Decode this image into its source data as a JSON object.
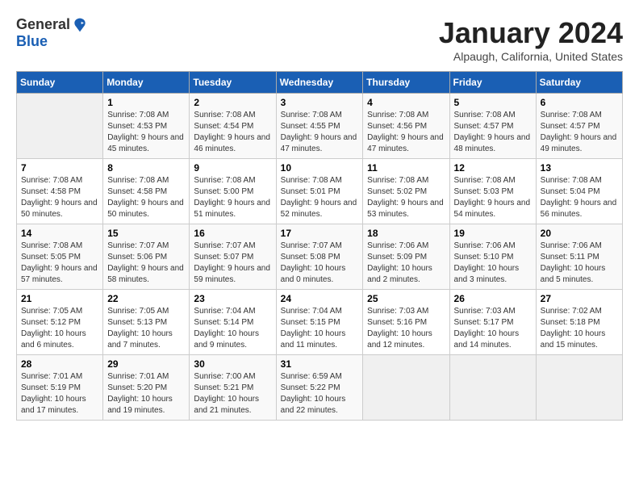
{
  "logo": {
    "general": "General",
    "blue": "Blue"
  },
  "title": "January 2024",
  "location": "Alpaugh, California, United States",
  "days_header": [
    "Sunday",
    "Monday",
    "Tuesday",
    "Wednesday",
    "Thursday",
    "Friday",
    "Saturday"
  ],
  "weeks": [
    [
      {
        "day": "",
        "sunrise": "",
        "sunset": "",
        "daylight": ""
      },
      {
        "day": "1",
        "sunrise": "Sunrise: 7:08 AM",
        "sunset": "Sunset: 4:53 PM",
        "daylight": "Daylight: 9 hours and 45 minutes."
      },
      {
        "day": "2",
        "sunrise": "Sunrise: 7:08 AM",
        "sunset": "Sunset: 4:54 PM",
        "daylight": "Daylight: 9 hours and 46 minutes."
      },
      {
        "day": "3",
        "sunrise": "Sunrise: 7:08 AM",
        "sunset": "Sunset: 4:55 PM",
        "daylight": "Daylight: 9 hours and 47 minutes."
      },
      {
        "day": "4",
        "sunrise": "Sunrise: 7:08 AM",
        "sunset": "Sunset: 4:56 PM",
        "daylight": "Daylight: 9 hours and 47 minutes."
      },
      {
        "day": "5",
        "sunrise": "Sunrise: 7:08 AM",
        "sunset": "Sunset: 4:57 PM",
        "daylight": "Daylight: 9 hours and 48 minutes."
      },
      {
        "day": "6",
        "sunrise": "Sunrise: 7:08 AM",
        "sunset": "Sunset: 4:57 PM",
        "daylight": "Daylight: 9 hours and 49 minutes."
      }
    ],
    [
      {
        "day": "7",
        "sunrise": "Sunrise: 7:08 AM",
        "sunset": "Sunset: 4:58 PM",
        "daylight": "Daylight: 9 hours and 50 minutes."
      },
      {
        "day": "8",
        "sunrise": "Sunrise: 7:08 AM",
        "sunset": "Sunset: 4:58 PM",
        "daylight": "Daylight: 9 hours and 50 minutes."
      },
      {
        "day": "9",
        "sunrise": "Sunrise: 7:08 AM",
        "sunset": "Sunset: 5:00 PM",
        "daylight": "Daylight: 9 hours and 51 minutes."
      },
      {
        "day": "10",
        "sunrise": "Sunrise: 7:08 AM",
        "sunset": "Sunset: 5:01 PM",
        "daylight": "Daylight: 9 hours and 52 minutes."
      },
      {
        "day": "11",
        "sunrise": "Sunrise: 7:08 AM",
        "sunset": "Sunset: 5:02 PM",
        "daylight": "Daylight: 9 hours and 53 minutes."
      },
      {
        "day": "12",
        "sunrise": "Sunrise: 7:08 AM",
        "sunset": "Sunset: 5:03 PM",
        "daylight": "Daylight: 9 hours and 54 minutes."
      },
      {
        "day": "13",
        "sunrise": "Sunrise: 7:08 AM",
        "sunset": "Sunset: 5:04 PM",
        "daylight": "Daylight: 9 hours and 56 minutes."
      }
    ],
    [
      {
        "day": "14",
        "sunrise": "Sunrise: 7:08 AM",
        "sunset": "Sunset: 5:05 PM",
        "daylight": "Daylight: 9 hours and 57 minutes."
      },
      {
        "day": "15",
        "sunrise": "Sunrise: 7:07 AM",
        "sunset": "Sunset: 5:06 PM",
        "daylight": "Daylight: 9 hours and 58 minutes."
      },
      {
        "day": "16",
        "sunrise": "Sunrise: 7:07 AM",
        "sunset": "Sunset: 5:07 PM",
        "daylight": "Daylight: 9 hours and 59 minutes."
      },
      {
        "day": "17",
        "sunrise": "Sunrise: 7:07 AM",
        "sunset": "Sunset: 5:08 PM",
        "daylight": "Daylight: 10 hours and 0 minutes."
      },
      {
        "day": "18",
        "sunrise": "Sunrise: 7:06 AM",
        "sunset": "Sunset: 5:09 PM",
        "daylight": "Daylight: 10 hours and 2 minutes."
      },
      {
        "day": "19",
        "sunrise": "Sunrise: 7:06 AM",
        "sunset": "Sunset: 5:10 PM",
        "daylight": "Daylight: 10 hours and 3 minutes."
      },
      {
        "day": "20",
        "sunrise": "Sunrise: 7:06 AM",
        "sunset": "Sunset: 5:11 PM",
        "daylight": "Daylight: 10 hours and 5 minutes."
      }
    ],
    [
      {
        "day": "21",
        "sunrise": "Sunrise: 7:05 AM",
        "sunset": "Sunset: 5:12 PM",
        "daylight": "Daylight: 10 hours and 6 minutes."
      },
      {
        "day": "22",
        "sunrise": "Sunrise: 7:05 AM",
        "sunset": "Sunset: 5:13 PM",
        "daylight": "Daylight: 10 hours and 7 minutes."
      },
      {
        "day": "23",
        "sunrise": "Sunrise: 7:04 AM",
        "sunset": "Sunset: 5:14 PM",
        "daylight": "Daylight: 10 hours and 9 minutes."
      },
      {
        "day": "24",
        "sunrise": "Sunrise: 7:04 AM",
        "sunset": "Sunset: 5:15 PM",
        "daylight": "Daylight: 10 hours and 11 minutes."
      },
      {
        "day": "25",
        "sunrise": "Sunrise: 7:03 AM",
        "sunset": "Sunset: 5:16 PM",
        "daylight": "Daylight: 10 hours and 12 minutes."
      },
      {
        "day": "26",
        "sunrise": "Sunrise: 7:03 AM",
        "sunset": "Sunset: 5:17 PM",
        "daylight": "Daylight: 10 hours and 14 minutes."
      },
      {
        "day": "27",
        "sunrise": "Sunrise: 7:02 AM",
        "sunset": "Sunset: 5:18 PM",
        "daylight": "Daylight: 10 hours and 15 minutes."
      }
    ],
    [
      {
        "day": "28",
        "sunrise": "Sunrise: 7:01 AM",
        "sunset": "Sunset: 5:19 PM",
        "daylight": "Daylight: 10 hours and 17 minutes."
      },
      {
        "day": "29",
        "sunrise": "Sunrise: 7:01 AM",
        "sunset": "Sunset: 5:20 PM",
        "daylight": "Daylight: 10 hours and 19 minutes."
      },
      {
        "day": "30",
        "sunrise": "Sunrise: 7:00 AM",
        "sunset": "Sunset: 5:21 PM",
        "daylight": "Daylight: 10 hours and 21 minutes."
      },
      {
        "day": "31",
        "sunrise": "Sunrise: 6:59 AM",
        "sunset": "Sunset: 5:22 PM",
        "daylight": "Daylight: 10 hours and 22 minutes."
      },
      {
        "day": "",
        "sunrise": "",
        "sunset": "",
        "daylight": ""
      },
      {
        "day": "",
        "sunrise": "",
        "sunset": "",
        "daylight": ""
      },
      {
        "day": "",
        "sunrise": "",
        "sunset": "",
        "daylight": ""
      }
    ]
  ]
}
